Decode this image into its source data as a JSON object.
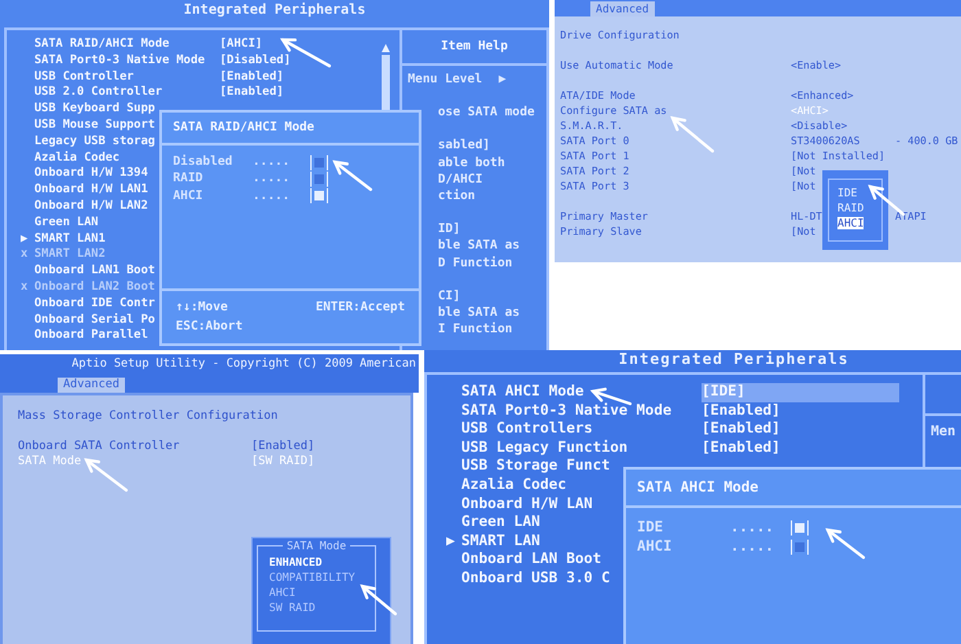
{
  "panels": [
    {
      "kind": "award",
      "title": "Integrated Peripherals",
      "items": [
        {
          "label": "SATA RAID/AHCI Mode",
          "value": "[AHCI]"
        },
        {
          "label": "SATA Port0-3 Native Mode",
          "value": "[Disabled]"
        },
        {
          "label": "USB Controller",
          "value": "[Enabled]"
        },
        {
          "label": "USB 2.0 Controller",
          "value": "[Enabled]"
        },
        {
          "label": "USB Keyboard Supp"
        },
        {
          "label": "USB Mouse Support"
        },
        {
          "label": "Legacy USB storag"
        },
        {
          "label": "Azalia Codec"
        },
        {
          "label": "Onboard H/W 1394"
        },
        {
          "label": "Onboard H/W LAN1"
        },
        {
          "label": "Onboard H/W LAN2"
        },
        {
          "label": "Green LAN"
        },
        {
          "label": "SMART LAN1",
          "marker": "▶"
        },
        {
          "label": "SMART LAN2",
          "marker": "x",
          "disabled": true
        },
        {
          "label": "Onboard LAN1 Boot"
        },
        {
          "label": "Onboard LAN2 Boot",
          "marker": "x",
          "disabled": true
        },
        {
          "label": "Onboard IDE Contr"
        },
        {
          "label": "Onboard Serial Po"
        },
        {
          "label": "Onboard Parallel"
        }
      ],
      "help": {
        "title": "Item Help",
        "menu_level": "Menu Level",
        "menu_arrow": "▶",
        "paragraphs": [
          [
            "ose SATA mode"
          ],
          [
            "sabled]",
            "able both",
            "D/AHCI",
            "ction"
          ],
          [
            "ID]",
            "ble SATA as",
            "D Function"
          ],
          [
            "CI]",
            "ble SATA as",
            "I Function"
          ]
        ]
      },
      "popup": {
        "title": "SATA RAID/AHCI Mode",
        "options": [
          {
            "label": "Disabled",
            "dots": ".....",
            "selected": false
          },
          {
            "label": "RAID",
            "dots": ".....",
            "selected": false
          },
          {
            "label": "AHCI",
            "dots": ".....",
            "selected": true
          }
        ],
        "footer": [
          "↑↓:Move",
          "ENTER:Accept",
          "ESC:Abort"
        ]
      }
    },
    {
      "kind": "drive",
      "tab": "Advanced",
      "heading": "Drive Configuration",
      "groups": [
        [
          {
            "label": "Use Automatic Mode",
            "value": "<Enable>"
          }
        ],
        [
          {
            "label": "ATA/IDE Mode",
            "value": "<Enhanced>"
          },
          {
            "label": "Configure SATA as",
            "value": "<AHCI>",
            "highlighted": true
          },
          {
            "label": "S.M.A.R.T.",
            "value": "<Disable>"
          },
          {
            "label": "SATA Port 0",
            "value": "ST3400620AS",
            "extra": "- 400.0 GB"
          },
          {
            "label": "SATA Port 1",
            "value": "[Not Installed]"
          },
          {
            "label": "SATA Port 2",
            "value": "[Not"
          },
          {
            "label": "SATA Port 3",
            "value": "[Not"
          }
        ],
        [
          {
            "label": "Primary Master",
            "value": "HL-DT",
            "extra": "ATAPI"
          },
          {
            "label": "Primary Slave",
            "value": "[Not"
          }
        ]
      ],
      "popup": {
        "options": [
          {
            "label": "IDE",
            "selected": false
          },
          {
            "label": "RAID",
            "selected": false
          },
          {
            "label": "AHCI",
            "selected": true
          }
        ]
      }
    },
    {
      "kind": "aptio",
      "title": "Aptio Setup Utility - Copyright (C) 2009 American",
      "tab": "Advanced",
      "heading": "Mass Storage Controller Configuration",
      "rows": [
        {
          "label": "Onboard SATA Controller",
          "value": "[Enabled]",
          "highlighted": false
        },
        {
          "label": "SATA Mode",
          "value": "[SW RAID]",
          "highlighted": true
        }
      ],
      "popup": {
        "title": "SATA Mode",
        "options": [
          {
            "label": "ENHANCED",
            "selected": true
          },
          {
            "label": "COMPATIBILITY",
            "selected": false
          },
          {
            "label": "AHCI",
            "selected": false
          },
          {
            "label": "SW RAID",
            "selected": false
          }
        ]
      }
    },
    {
      "kind": "award2",
      "title": "Integrated Peripherals",
      "items": [
        {
          "label": "SATA AHCI Mode",
          "value": "[IDE]",
          "highlighted": true
        },
        {
          "label": "SATA Port0-3 Native Mode",
          "value": "[Enabled]"
        },
        {
          "label": "USB Controllers",
          "value": "[Enabled]"
        },
        {
          "label": "USB Legacy Function",
          "value": "[Enabled]"
        },
        {
          "label": "USB Storage Funct"
        },
        {
          "label": "Azalia Codec"
        },
        {
          "label": "Onboard H/W LAN"
        },
        {
          "label": "Green LAN"
        },
        {
          "label": "SMART LAN",
          "marker": "▶"
        },
        {
          "label": "Onboard LAN Boot"
        },
        {
          "label": "Onboard USB 3.0 C"
        }
      ],
      "help": {
        "menu_level": "Men"
      },
      "popup": {
        "title": "SATA AHCI Mode",
        "options": [
          {
            "label": "IDE",
            "dots": ".....",
            "selected": true
          },
          {
            "label": "AHCI",
            "dots": ".....",
            "selected": false
          }
        ]
      }
    }
  ]
}
